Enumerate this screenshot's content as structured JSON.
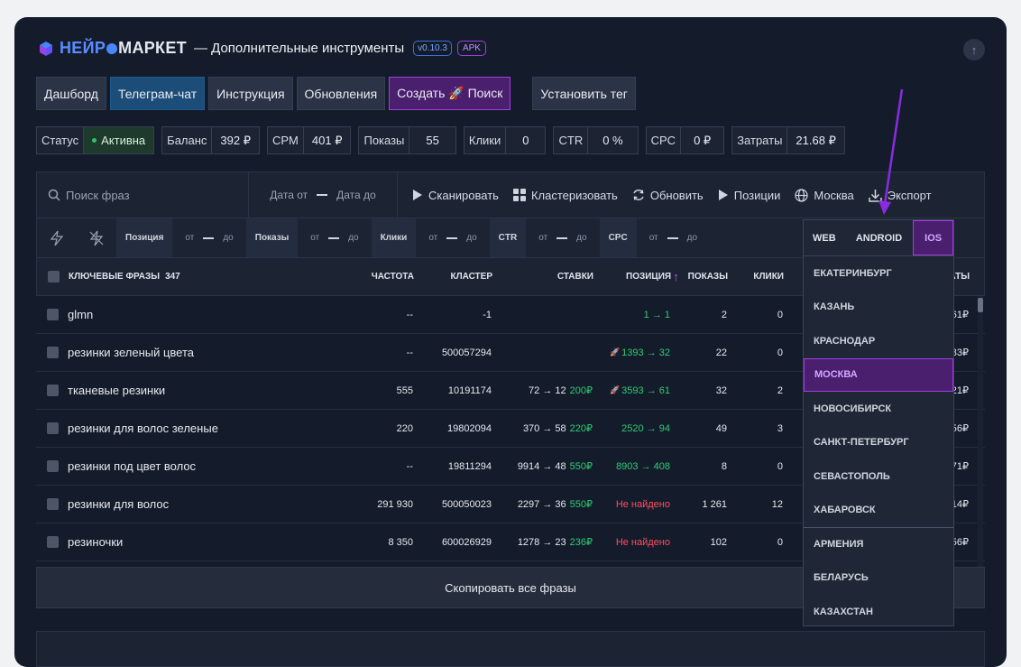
{
  "header": {
    "brand_part1": "НЕЙР",
    "brand_part2": "МАРКЕТ",
    "subtitle": "— Дополнительные инструменты",
    "version": "v0.10.3",
    "apk": "APK"
  },
  "nav": {
    "dashboard": "Дашборд",
    "telegram": "Телеграм-чат",
    "instruction": "Инструкция",
    "updates": "Обновления",
    "create_search": "Создать 🚀 Поиск",
    "set_tag": "Установить тег"
  },
  "stats": [
    {
      "key": "Статус",
      "value": "Активна"
    },
    {
      "key": "Баланс",
      "value": "392 ₽"
    },
    {
      "key": "CPM",
      "value": "401 ₽"
    },
    {
      "key": "Показы",
      "value": "55"
    },
    {
      "key": "Клики",
      "value": "0"
    },
    {
      "key": "CTR",
      "value": "0 %"
    },
    {
      "key": "CPC",
      "value": "0 ₽"
    },
    {
      "key": "Затраты",
      "value": "21.68 ₽"
    }
  ],
  "toolbar": {
    "search_placeholder": "Поиск фраз",
    "date_from": "Дата от",
    "date_to": "Дата до",
    "scan": "Сканировать",
    "cluster": "Кластеризовать",
    "refresh": "Обновить",
    "positions": "Позиции",
    "region": "Москва",
    "export": "Экспорт"
  },
  "filters": {
    "position": "Позиция",
    "shows": "Показы",
    "clicks": "Клики",
    "ctr": "CTR",
    "cpc": "CPC",
    "from": "от",
    "to": "до"
  },
  "table": {
    "headers": {
      "phrases": "КЛЮЧЕВЫЕ ФРАЗЫ",
      "count": "347",
      "freq": "ЧАСТОТА",
      "cluster": "КЛАСТЕР",
      "bids": "СТАВКИ",
      "position": "ПОЗИЦИЯ",
      "shows": "ПОКАЗЫ",
      "clicks": "КЛИКИ",
      "cost_tail": "АТЫ"
    },
    "rows": [
      {
        "phrase": "glmn",
        "freq": "--",
        "cluster": "-1",
        "bid": "",
        "bid_price": "",
        "pos": "1 → 1",
        "pos_rocket": "",
        "pos_class": "grn",
        "shows": "2",
        "clicks": "0",
        "cost": "61₽"
      },
      {
        "phrase": "резинки зеленый цвета",
        "freq": "--",
        "cluster": "500057294",
        "bid": "",
        "bid_price": "",
        "pos": "1393 → 32",
        "pos_rocket": "🚀",
        "pos_class": "grn",
        "shows": "22",
        "clicks": "0",
        "cost": "83₽"
      },
      {
        "phrase": "тканевые резинки",
        "freq": "555",
        "cluster": "10191174",
        "bid": "72 → 12",
        "bid_price": "200₽",
        "pos": "3593 → 61",
        "pos_rocket": "🚀",
        "pos_class": "grn",
        "shows": "32",
        "clicks": "2",
        "cost": "21₽"
      },
      {
        "phrase": "резинки для волос зеленые",
        "freq": "220",
        "cluster": "19802094",
        "bid": "370 → 58",
        "bid_price": "220₽",
        "pos": "2520 → 94",
        "pos_rocket": "",
        "pos_class": "grn",
        "shows": "49",
        "clicks": "3",
        "cost": "56₽"
      },
      {
        "phrase": "резинки под цвет волос",
        "freq": "--",
        "cluster": "19811294",
        "bid": "9914 → 48",
        "bid_price": "550₽",
        "pos": "8903 → 408",
        "pos_rocket": "",
        "pos_class": "grn",
        "shows": "8",
        "clicks": "0",
        "cost": "71₽"
      },
      {
        "phrase": "резинки для волос",
        "freq": "291 930",
        "cluster": "500050023",
        "bid": "2297 → 36",
        "bid_price": "550₽",
        "pos": "Не найдено",
        "pos_rocket": "",
        "pos_class": "red",
        "shows": "1 261",
        "clicks": "12",
        "cost": "14₽"
      },
      {
        "phrase": "резиночки",
        "freq": "8 350",
        "cluster": "600026929",
        "bid": "1278 → 23",
        "bid_price": "236₽",
        "pos": "Не найдено",
        "pos_rocket": "",
        "pos_class": "red",
        "shows": "102",
        "clicks": "0",
        "cost": "56₽"
      }
    ]
  },
  "copy_all": "Скопировать все фразы",
  "dropdown": {
    "tabs": [
      "WEB",
      "ANDROID",
      "IOS"
    ],
    "active_tab": "IOS",
    "cities": [
      "ЕКАТЕРИНБУРГ",
      "КАЗАНЬ",
      "КРАСНОДАР",
      "МОСКВА",
      "НОВОСИБИРСК",
      "САНКТ-ПЕТЕРБУРГ",
      "СЕВАСТОПОЛЬ",
      "ХАБАРОВСК"
    ],
    "selected_city": "МОСКВА",
    "countries": [
      "АРМЕНИЯ",
      "БЕЛАРУСЬ",
      "КАЗАХСТАН"
    ]
  },
  "colors": {
    "panel_bg": "#141c2b",
    "accent_purple": "#a13ee0",
    "accent_blue": "#1b4d78",
    "green": "#2ecc71",
    "red": "#ff4d5e"
  }
}
